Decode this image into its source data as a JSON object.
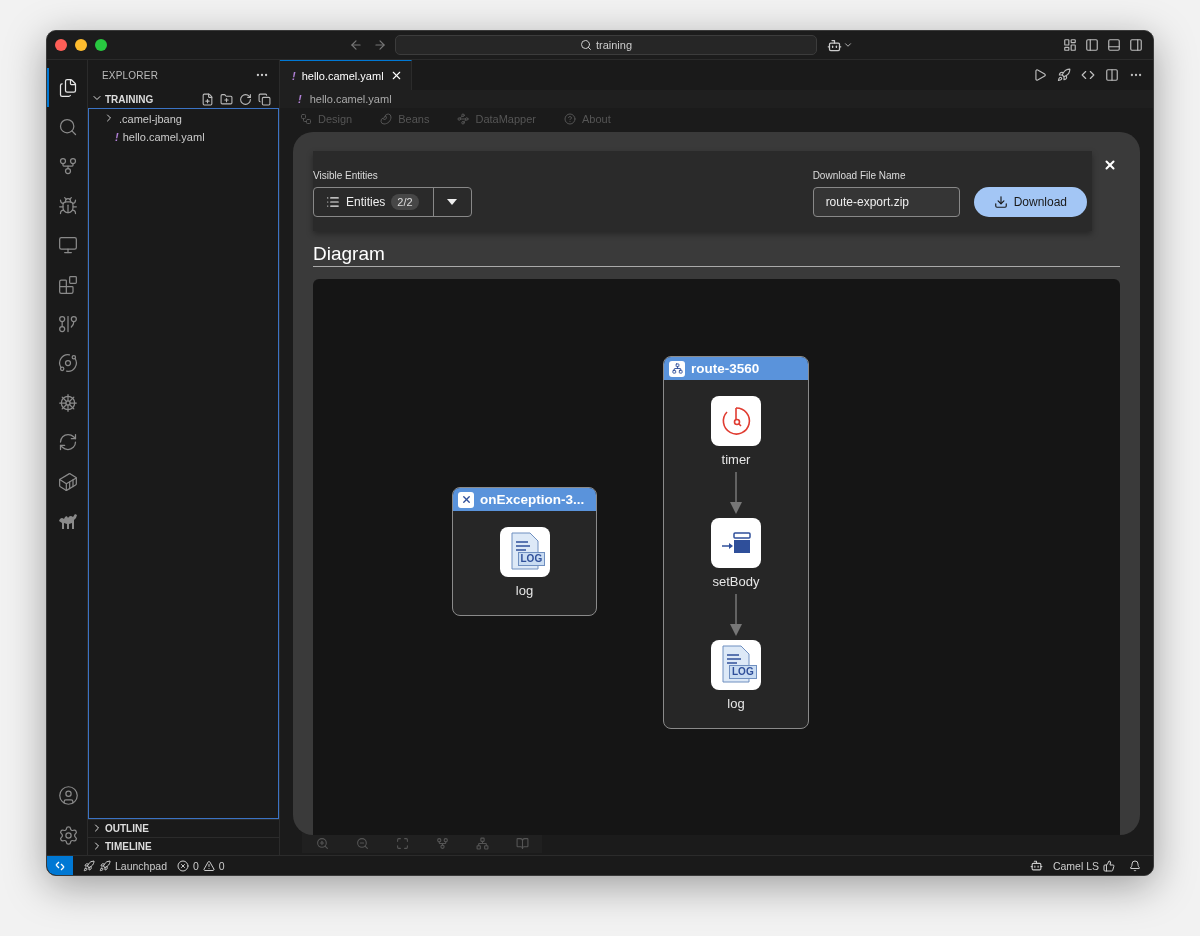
{
  "window": {
    "search": "training"
  },
  "activity_bar": [
    {
      "kind": "explorer",
      "selected": true
    },
    {
      "kind": "search",
      "selected": false
    },
    {
      "kind": "source-control",
      "selected": false
    },
    {
      "kind": "run",
      "selected": false
    },
    {
      "kind": "remote",
      "selected": false
    },
    {
      "kind": "extensions",
      "selected": false
    },
    {
      "kind": "git-graph",
      "selected": false
    },
    {
      "kind": "kaoto",
      "selected": false
    },
    {
      "kind": "kubernetes",
      "selected": false
    },
    {
      "kind": "sync",
      "selected": false
    },
    {
      "kind": "docker",
      "selected": false
    },
    {
      "kind": "camel",
      "selected": false
    }
  ],
  "sidebar": {
    "title": "EXPLORER",
    "folder": {
      "label": "TRAINING",
      "expanded": true,
      "children": [
        {
          "kind": "folder",
          "label": ".camel-jbang",
          "expanded": false
        },
        {
          "kind": "yaml",
          "marker": "!",
          "label": "hello.camel.yaml"
        }
      ]
    },
    "sections": [
      {
        "label": "OUTLINE",
        "expanded": false
      },
      {
        "label": "TIMELINE",
        "expanded": false
      }
    ]
  },
  "editor": {
    "tabs": [
      {
        "marker": "!",
        "label": "hello.camel.yaml",
        "selected": true
      }
    ],
    "breadcrumb": {
      "marker": "!",
      "label": "hello.camel.yaml"
    },
    "view_tabs": [
      {
        "kind": "design",
        "label": "Design"
      },
      {
        "kind": "beans",
        "label": "Beans"
      },
      {
        "kind": "datamapper",
        "label": "DataMapper"
      },
      {
        "kind": "about",
        "label": "About"
      }
    ]
  },
  "modal": {
    "visible_entities_label": "Visible Entities",
    "entities_button": {
      "label": "Entities",
      "count": "2/2"
    },
    "file_name_label": "Download File Name",
    "file_name": "route-export.zip",
    "download_button": "Download",
    "heading": "Diagram",
    "groups": [
      {
        "kind": "exception",
        "title": "onException-3...",
        "steps": [
          {
            "kind": "log",
            "label": "log",
            "icon_text": "LOG"
          }
        ]
      },
      {
        "kind": "route",
        "title": "route-3560",
        "steps": [
          {
            "kind": "timer",
            "label": "timer"
          },
          {
            "kind": "setbody",
            "label": "setBody"
          },
          {
            "kind": "log",
            "label": "log",
            "icon_text": "LOG"
          }
        ]
      }
    ]
  },
  "status_bar": {
    "launchpad": "Launchpad",
    "errors": "0",
    "warnings": "0",
    "language_server": "Camel LS"
  }
}
